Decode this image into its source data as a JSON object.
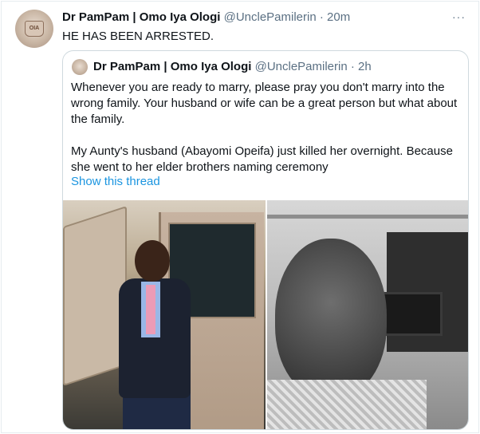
{
  "tweet": {
    "author_name": "Dr PamPam | Omo Iya Ologi",
    "handle": "@UnclePamilerin",
    "separator": "·",
    "time": "20m",
    "more_menu": "···",
    "text": "HE HAS BEEN ARRESTED."
  },
  "quote": {
    "author_name": "Dr PamPam | Omo Iya Ologi",
    "handle": "@UnclePamilerin",
    "separator": "·",
    "time": "2h",
    "paragraph_1": "Whenever you are ready to marry, please pray you don't marry into the wrong family. Your husband or wife can be a great person but what about the family.",
    "paragraph_2": "My Aunty's husband (Abayomi Opeifa) just killed her overnight. Because she went to her elder brothers naming ceremony",
    "thread_link": "Show this thread"
  },
  "colors": {
    "link": "#1b95e0",
    "secondary_text": "#5b7083",
    "border": "#cfd9de"
  },
  "icons": {
    "more": "more-horizontal-icon"
  }
}
